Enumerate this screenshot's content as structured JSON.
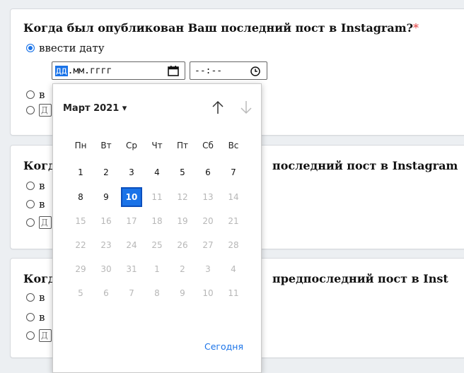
{
  "questions": [
    {
      "title": "Когда был опубликован Ваш последний пост в Instagram?",
      "required_mark": "*",
      "option_1": "ввести дату",
      "option_2_partial": "в",
      "option_3_mini": "Д"
    },
    {
      "title_left": "Когд",
      "title_right": "последний пост в Instagram",
      "option_1_partial": "в",
      "option_2_partial": "в",
      "option_3_mini": "Д"
    },
    {
      "title_left": "Когд",
      "title_right": "предпоследний пост в Inst",
      "option_1_partial": "в",
      "option_2_partial": "в",
      "option_3_mini": "Д"
    }
  ],
  "date_input": {
    "day_seg": "дд",
    "rest": ".мм.гггг",
    "icon": "calendar-icon"
  },
  "time_input": {
    "value": "--:--",
    "icon": "clock-icon"
  },
  "calendar": {
    "month_label": "Март 2021 ▾",
    "weekdays": [
      "Пн",
      "Вт",
      "Ср",
      "Чт",
      "Пт",
      "Сб",
      "Вс"
    ],
    "weeks": [
      [
        "1",
        "2",
        "3",
        "4",
        "5",
        "6",
        "7"
      ],
      [
        "8",
        "9",
        "10",
        "11",
        "12",
        "13",
        "14"
      ],
      [
        "15",
        "16",
        "17",
        "18",
        "19",
        "20",
        "21"
      ],
      [
        "22",
        "23",
        "24",
        "25",
        "26",
        "27",
        "28"
      ],
      [
        "29",
        "30",
        "31",
        "1",
        "2",
        "3",
        "4"
      ],
      [
        "5",
        "6",
        "7",
        "8",
        "9",
        "10",
        "11"
      ]
    ],
    "selected_day": "10",
    "today_label": "Сегодня",
    "accent": "#1a73e8"
  }
}
